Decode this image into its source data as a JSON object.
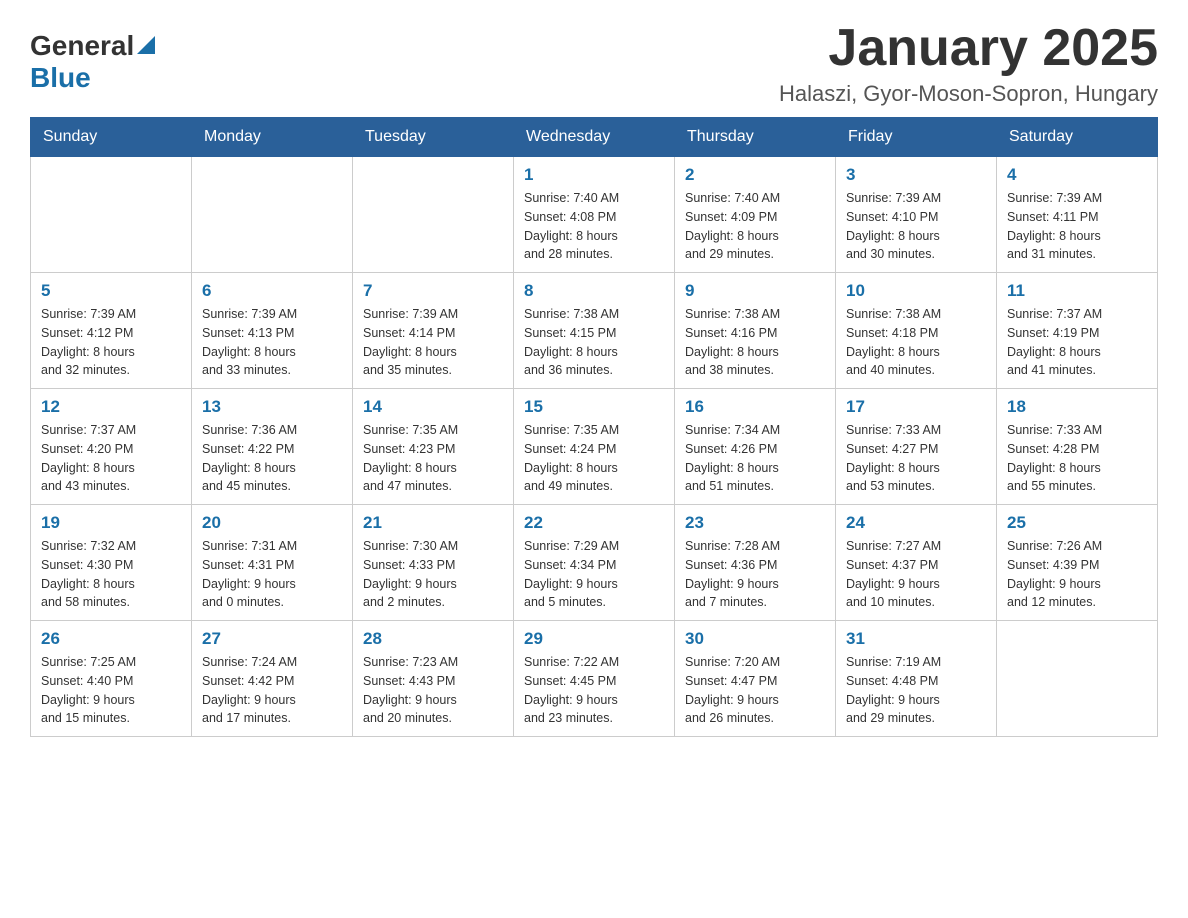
{
  "header": {
    "logo_general": "General",
    "logo_blue": "Blue",
    "title": "January 2025",
    "subtitle": "Halaszi, Gyor-Moson-Sopron, Hungary"
  },
  "weekdays": [
    "Sunday",
    "Monday",
    "Tuesday",
    "Wednesday",
    "Thursday",
    "Friday",
    "Saturday"
  ],
  "weeks": [
    [
      {
        "day": "",
        "info": ""
      },
      {
        "day": "",
        "info": ""
      },
      {
        "day": "",
        "info": ""
      },
      {
        "day": "1",
        "info": "Sunrise: 7:40 AM\nSunset: 4:08 PM\nDaylight: 8 hours\nand 28 minutes."
      },
      {
        "day": "2",
        "info": "Sunrise: 7:40 AM\nSunset: 4:09 PM\nDaylight: 8 hours\nand 29 minutes."
      },
      {
        "day": "3",
        "info": "Sunrise: 7:39 AM\nSunset: 4:10 PM\nDaylight: 8 hours\nand 30 minutes."
      },
      {
        "day": "4",
        "info": "Sunrise: 7:39 AM\nSunset: 4:11 PM\nDaylight: 8 hours\nand 31 minutes."
      }
    ],
    [
      {
        "day": "5",
        "info": "Sunrise: 7:39 AM\nSunset: 4:12 PM\nDaylight: 8 hours\nand 32 minutes."
      },
      {
        "day": "6",
        "info": "Sunrise: 7:39 AM\nSunset: 4:13 PM\nDaylight: 8 hours\nand 33 minutes."
      },
      {
        "day": "7",
        "info": "Sunrise: 7:39 AM\nSunset: 4:14 PM\nDaylight: 8 hours\nand 35 minutes."
      },
      {
        "day": "8",
        "info": "Sunrise: 7:38 AM\nSunset: 4:15 PM\nDaylight: 8 hours\nand 36 minutes."
      },
      {
        "day": "9",
        "info": "Sunrise: 7:38 AM\nSunset: 4:16 PM\nDaylight: 8 hours\nand 38 minutes."
      },
      {
        "day": "10",
        "info": "Sunrise: 7:38 AM\nSunset: 4:18 PM\nDaylight: 8 hours\nand 40 minutes."
      },
      {
        "day": "11",
        "info": "Sunrise: 7:37 AM\nSunset: 4:19 PM\nDaylight: 8 hours\nand 41 minutes."
      }
    ],
    [
      {
        "day": "12",
        "info": "Sunrise: 7:37 AM\nSunset: 4:20 PM\nDaylight: 8 hours\nand 43 minutes."
      },
      {
        "day": "13",
        "info": "Sunrise: 7:36 AM\nSunset: 4:22 PM\nDaylight: 8 hours\nand 45 minutes."
      },
      {
        "day": "14",
        "info": "Sunrise: 7:35 AM\nSunset: 4:23 PM\nDaylight: 8 hours\nand 47 minutes."
      },
      {
        "day": "15",
        "info": "Sunrise: 7:35 AM\nSunset: 4:24 PM\nDaylight: 8 hours\nand 49 minutes."
      },
      {
        "day": "16",
        "info": "Sunrise: 7:34 AM\nSunset: 4:26 PM\nDaylight: 8 hours\nand 51 minutes."
      },
      {
        "day": "17",
        "info": "Sunrise: 7:33 AM\nSunset: 4:27 PM\nDaylight: 8 hours\nand 53 minutes."
      },
      {
        "day": "18",
        "info": "Sunrise: 7:33 AM\nSunset: 4:28 PM\nDaylight: 8 hours\nand 55 minutes."
      }
    ],
    [
      {
        "day": "19",
        "info": "Sunrise: 7:32 AM\nSunset: 4:30 PM\nDaylight: 8 hours\nand 58 minutes."
      },
      {
        "day": "20",
        "info": "Sunrise: 7:31 AM\nSunset: 4:31 PM\nDaylight: 9 hours\nand 0 minutes."
      },
      {
        "day": "21",
        "info": "Sunrise: 7:30 AM\nSunset: 4:33 PM\nDaylight: 9 hours\nand 2 minutes."
      },
      {
        "day": "22",
        "info": "Sunrise: 7:29 AM\nSunset: 4:34 PM\nDaylight: 9 hours\nand 5 minutes."
      },
      {
        "day": "23",
        "info": "Sunrise: 7:28 AM\nSunset: 4:36 PM\nDaylight: 9 hours\nand 7 minutes."
      },
      {
        "day": "24",
        "info": "Sunrise: 7:27 AM\nSunset: 4:37 PM\nDaylight: 9 hours\nand 10 minutes."
      },
      {
        "day": "25",
        "info": "Sunrise: 7:26 AM\nSunset: 4:39 PM\nDaylight: 9 hours\nand 12 minutes."
      }
    ],
    [
      {
        "day": "26",
        "info": "Sunrise: 7:25 AM\nSunset: 4:40 PM\nDaylight: 9 hours\nand 15 minutes."
      },
      {
        "day": "27",
        "info": "Sunrise: 7:24 AM\nSunset: 4:42 PM\nDaylight: 9 hours\nand 17 minutes."
      },
      {
        "day": "28",
        "info": "Sunrise: 7:23 AM\nSunset: 4:43 PM\nDaylight: 9 hours\nand 20 minutes."
      },
      {
        "day": "29",
        "info": "Sunrise: 7:22 AM\nSunset: 4:45 PM\nDaylight: 9 hours\nand 23 minutes."
      },
      {
        "day": "30",
        "info": "Sunrise: 7:20 AM\nSunset: 4:47 PM\nDaylight: 9 hours\nand 26 minutes."
      },
      {
        "day": "31",
        "info": "Sunrise: 7:19 AM\nSunset: 4:48 PM\nDaylight: 9 hours\nand 29 minutes."
      },
      {
        "day": "",
        "info": ""
      }
    ]
  ]
}
